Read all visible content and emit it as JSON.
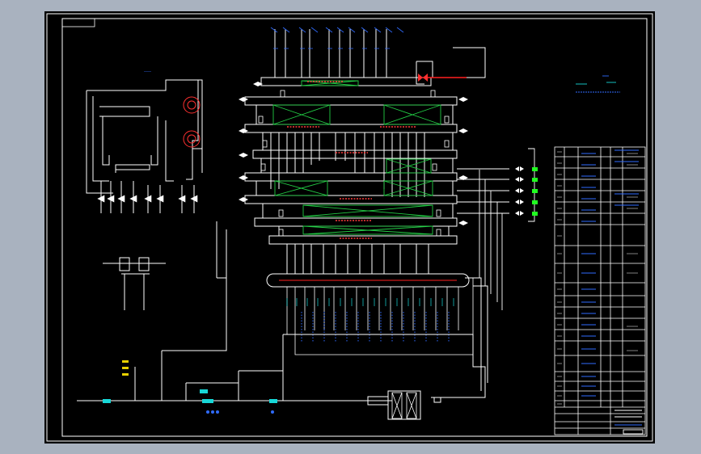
{
  "colors": {
    "background": "#000000",
    "frame": "#ffffff",
    "pipe": "#ffffff",
    "header_label": "#ff3b3b",
    "panel_cross": "#22cc44",
    "valve_tags": "#2f6bff",
    "instrument": "#18d7d7",
    "drum_hot_line": "#ff2020",
    "yellow_tag": "#e8d000",
    "green_outlet": "#20ff20",
    "outer_border": "#a9b2bf"
  },
  "icons": {
    "valve": "bowtie-valve-icon",
    "circulating_pump": "circle-pump-icon",
    "heat_exchanger": "crossed-box-icon",
    "outlet_arrow": "green-arrow-icon"
  }
}
